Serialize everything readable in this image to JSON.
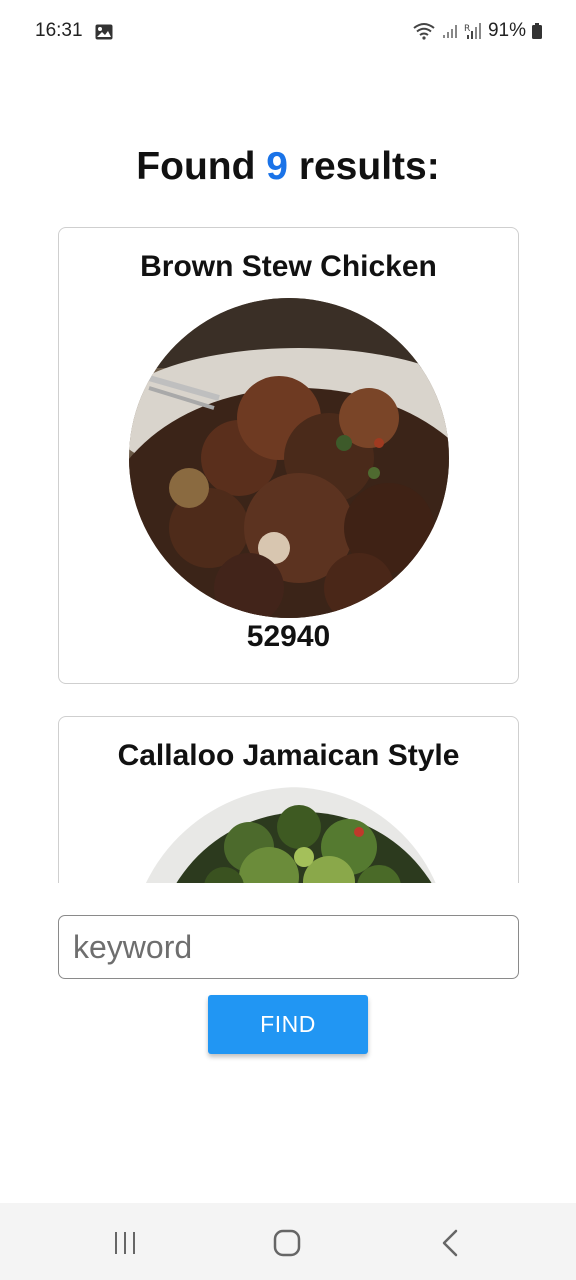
{
  "status_bar": {
    "time": "16:31",
    "battery": "91%"
  },
  "heading": {
    "prefix": "Found",
    "count": "9",
    "suffix": "results:"
  },
  "results": [
    {
      "title": "Brown Stew Chicken",
      "number": "52940"
    },
    {
      "title": "Callaloo Jamaican Style"
    }
  ],
  "search": {
    "placeholder": "keyword",
    "value": "",
    "button_label": "FIND"
  },
  "colors": {
    "accent": "#1a73e8",
    "button": "#2196f3"
  }
}
